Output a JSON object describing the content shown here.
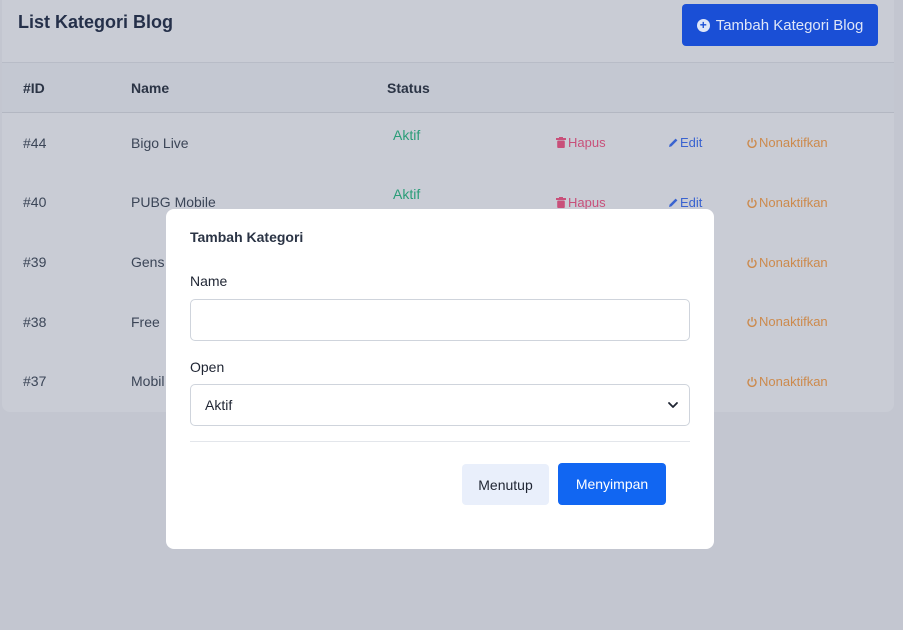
{
  "header": {
    "title": "List Kategori Blog",
    "add_button_label": "Tambah Kategori Blog"
  },
  "table": {
    "columns": [
      "#ID",
      "Name",
      "Status"
    ],
    "rows": [
      {
        "id": "#44",
        "name": "Bigo Live",
        "status": "Aktif"
      },
      {
        "id": "#40",
        "name": "PUBG Mobile",
        "status": "Aktif"
      },
      {
        "id": "#39",
        "name": "Gens"
      },
      {
        "id": "#38",
        "name": "Free"
      },
      {
        "id": "#37",
        "name": "Mobil"
      }
    ],
    "actions": {
      "delete": "Hapus",
      "edit": "Edit",
      "deactivate": "Nonaktifkan"
    }
  },
  "modal": {
    "title": "Tambah Kategori",
    "name_label": "Name",
    "name_value": "",
    "open_label": "Open",
    "open_selected": "Aktif",
    "close_button": "Menutup",
    "save_button": "Menyimpan"
  },
  "colors": {
    "primary": "#1166f2",
    "status_active": "#2a9d78",
    "delete": "#c8507a",
    "edit": "#3a63d0",
    "deactivate": "#cc8a4d"
  }
}
